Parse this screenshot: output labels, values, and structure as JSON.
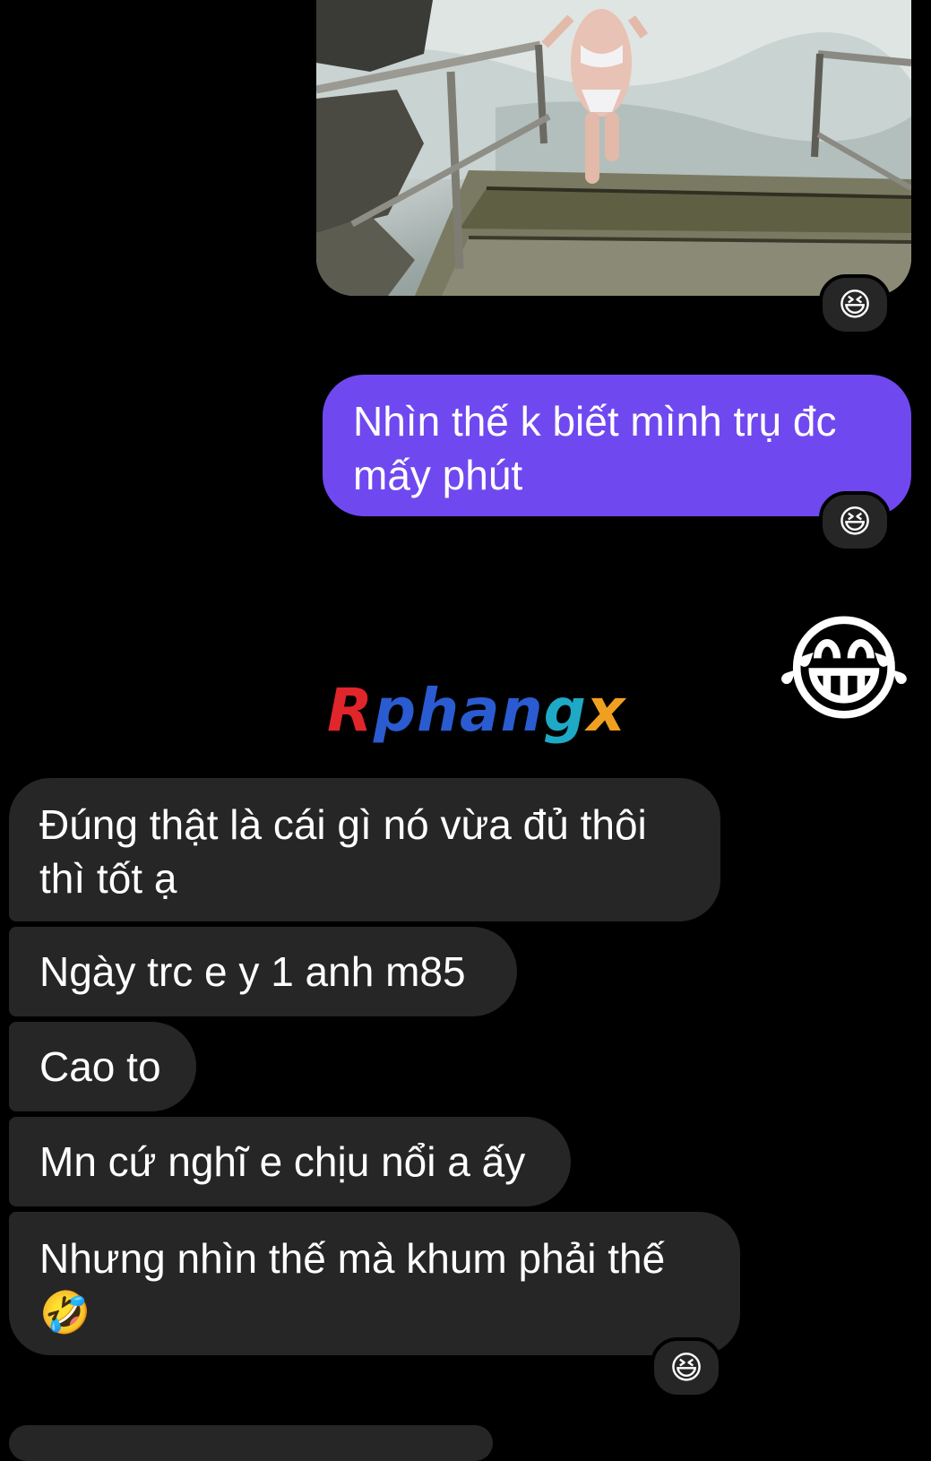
{
  "messages": {
    "outgoing": [
      {
        "text": "Nhìn thế k biết mình trụ đc mấy phút",
        "reaction": "😆"
      }
    ],
    "photo": {
      "reaction": "😆"
    },
    "big_emoji": "😂",
    "incoming": [
      {
        "text": "Đúng thật là cái gì nó vừa đủ thôi thì tốt ạ"
      },
      {
        "text": "Ngày trc e y 1 anh m85"
      },
      {
        "text": "Cao to"
      },
      {
        "text": "Mn cứ nghĩ e chịu nổi a ấy"
      },
      {
        "text": "Nhưng nhìn thế mà khum phải thế 🤣",
        "reaction": "😆"
      }
    ]
  },
  "watermark": {
    "part1": "R",
    "part2": "phan",
    "part3": "g",
    "part4": "x"
  },
  "colors": {
    "background": "#000000",
    "outgoing_bubble": "#7048f0",
    "incoming_bubble": "#262626",
    "reaction_pill": "#262626"
  },
  "icons": {
    "reaction": "grinning-squinting-face-emoji",
    "big_emoji": "face-with-tears-of-joy-emoji",
    "inline_emoji": "rolling-on-floor-laughing-emoji"
  }
}
